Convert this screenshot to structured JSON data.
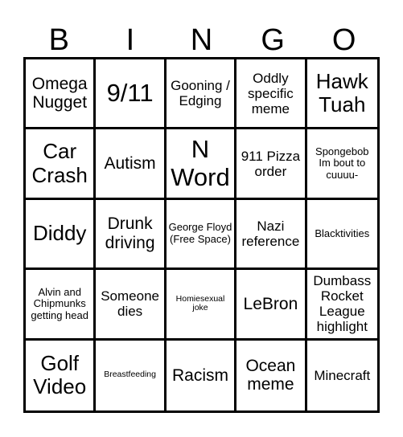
{
  "header": {
    "letters": [
      "B",
      "I",
      "N",
      "G",
      "O"
    ]
  },
  "grid": {
    "rows": [
      [
        "Omega Nugget",
        "9/11",
        "Gooning / Edging",
        "Oddly specific meme",
        "Hawk Tuah"
      ],
      [
        "Car Crash",
        "Autism",
        "N Word",
        "911 Pizza order",
        "Spongebob Im bout to cuuuu-"
      ],
      [
        "Diddy",
        "Drunk driving",
        "George Floyd (Free Space)",
        "Nazi reference",
        "Blacktivities"
      ],
      [
        "Alvin and Chipmunks getting head",
        "Someone dies",
        "Homiesexual joke",
        "LeBron",
        "Dumbass Rocket League highlight"
      ],
      [
        "Golf Video",
        "Breastfeeding",
        "Racism",
        "Ocean meme",
        "Minecraft"
      ]
    ]
  }
}
